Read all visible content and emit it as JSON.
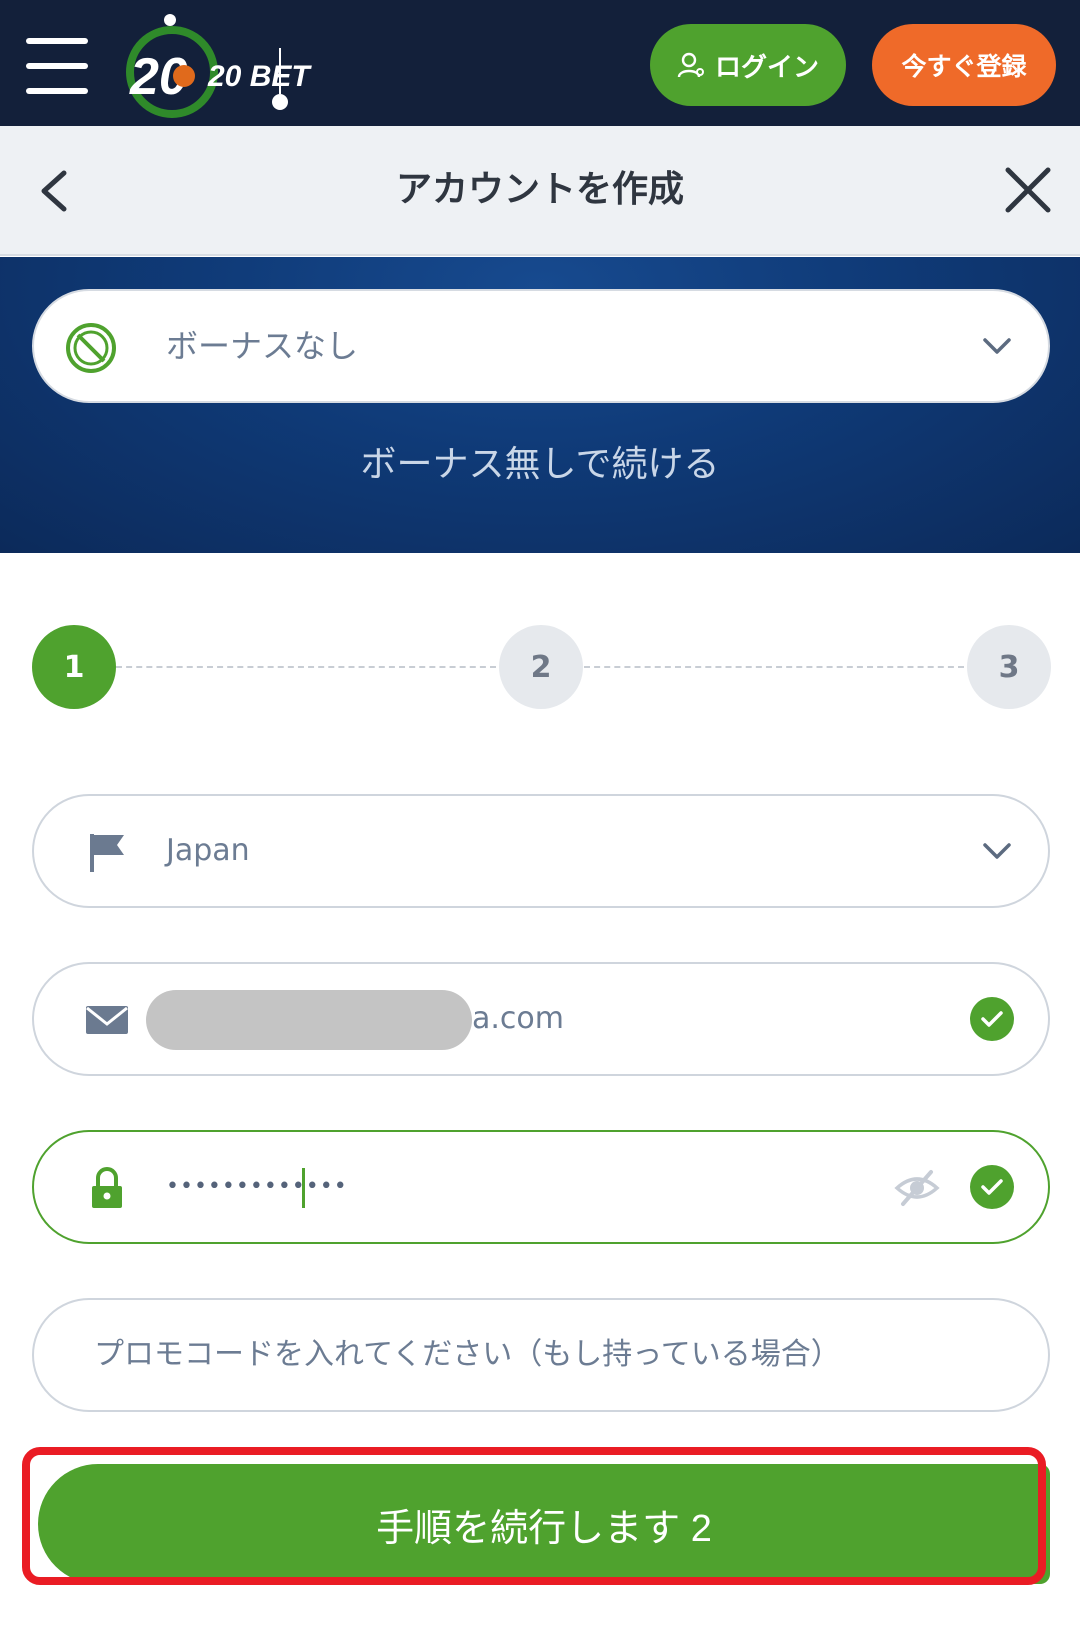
{
  "brand": {
    "logo_text": "20 BET"
  },
  "header": {
    "login_label": "ログイン",
    "register_label": "今すぐ登録"
  },
  "modal": {
    "title": "アカウントを作成"
  },
  "bonus": {
    "selected": "ボーナスなし",
    "continue_without": "ボーナス無しで続ける"
  },
  "steps": [
    "1",
    "2",
    "3"
  ],
  "form": {
    "country": "Japan",
    "email_suffix": "a.com",
    "password_mask": "•••••••••••••",
    "promo_placeholder": "プロモコードを入れてください（もし持っている場合）"
  },
  "cta": {
    "label": "手順を続行します 2"
  },
  "colors": {
    "green": "#4fa22e",
    "orange": "#ef6a29",
    "navy": "#13203a",
    "highlight": "#ea1c24"
  }
}
